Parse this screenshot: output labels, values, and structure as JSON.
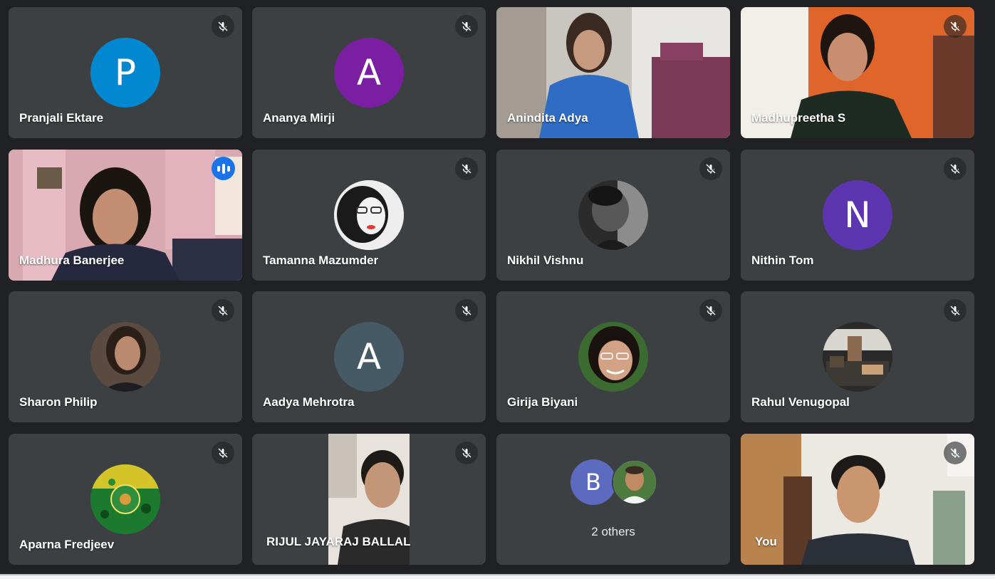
{
  "colors": {
    "tile_bg": "#3c4043",
    "page_bg": "#202124",
    "speaking_outline": "#8ab4f8",
    "speaking_indicator": "#1a73e8"
  },
  "participants": [
    {
      "name": "Pranjali Ektare",
      "initial": "P",
      "avatar_color": "#0288d1",
      "muted": true
    },
    {
      "name": "Ananya Mirji",
      "initial": "A",
      "avatar_color": "#7b1fa2",
      "muted": true
    },
    {
      "name": "Anindita Adya",
      "video": true,
      "muted": false
    },
    {
      "name": "Madhupreetha S",
      "video": true,
      "muted": true
    },
    {
      "name": "Madhura Banerjee",
      "video": true,
      "speaking": true
    },
    {
      "name": "Tamanna Mazumder",
      "photo": true,
      "muted": true
    },
    {
      "name": "Nikhil Vishnu",
      "photo": true,
      "muted": true
    },
    {
      "name": "Nithin Tom",
      "initial": "N",
      "avatar_color": "#5e35b1",
      "muted": true
    },
    {
      "name": "Sharon Philip",
      "photo": true,
      "muted": true
    },
    {
      "name": "Aadya Mehrotra",
      "initial": "A",
      "avatar_color": "#455a64",
      "muted": true
    },
    {
      "name": "Girija Biyani",
      "photo": true,
      "muted": true
    },
    {
      "name": "Rahul Venugopal",
      "photo": true,
      "muted": true
    },
    {
      "name": "Aparna Fredjeev",
      "photo": true,
      "muted": true
    },
    {
      "name": "RIJUL JAYARAJ BALLAL",
      "video": true,
      "muted": true
    },
    {
      "name": "2 others",
      "others": true,
      "initial": "B",
      "avatar_color": "#5c6bc0"
    },
    {
      "name": "You",
      "video": true,
      "muted": true
    }
  ],
  "icons": {
    "muted": "mic-off-icon",
    "speaking": "audio-level-icon"
  }
}
